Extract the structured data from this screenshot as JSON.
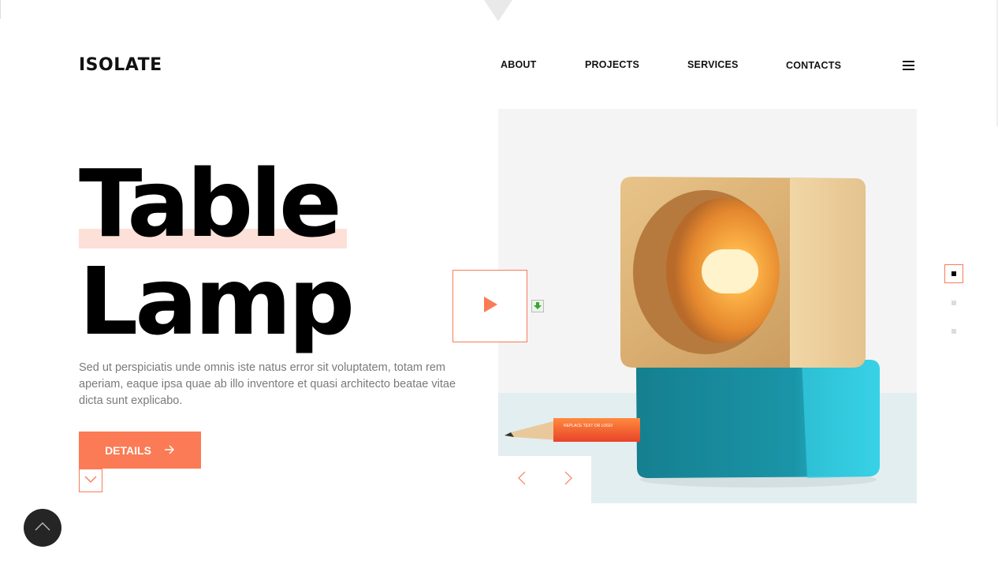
{
  "brand": {
    "logo": "ISOLATE"
  },
  "nav": {
    "items": [
      {
        "label": "ABOUT"
      },
      {
        "label": "PROJECTS"
      },
      {
        "label": "SERVICES"
      },
      {
        "label": "CONTACTS"
      }
    ],
    "menu_icon": "hamburger-menu-icon"
  },
  "hero": {
    "title_line1": "Table",
    "title_line2": "Lamp",
    "description": "Sed ut perspiciatis unde omnis iste natus error sit voluptatem, totam rem aperiam, eaque ipsa quae ab illo inventore et quasi architecto beatae vitae dicta sunt explicabo.",
    "details_label": "DETAILS",
    "pencil_text": "REPLACE TEXT OR LOGO"
  },
  "slider": {
    "active_index": 1,
    "total": 3
  },
  "colors": {
    "accent": "#fa7b55",
    "highlight": "#fde0d8",
    "dark": "#252525"
  },
  "icons": [
    "arrow-right-icon",
    "chevron-down-icon",
    "chevron-up-icon",
    "play-icon",
    "download-icon",
    "chevron-left-icon",
    "chevron-right-icon"
  ]
}
